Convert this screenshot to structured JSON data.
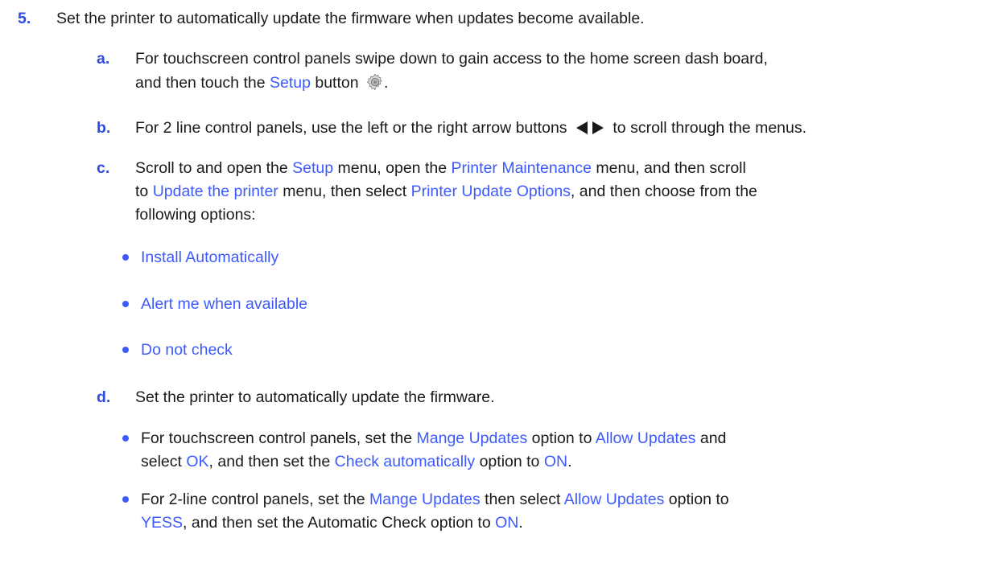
{
  "step5": {
    "num": "5.",
    "text": "Set the printer to automatically update the firmware when updates become available."
  },
  "a": {
    "label": "a.",
    "line1": "For touchscreen control panels swipe down to gain access to the home screen dash board,",
    "line2_pre": "and then touch the ",
    "line2_link": "Setup",
    "line2_mid": " button",
    "line2_post": "."
  },
  "b": {
    "label": "b.",
    "pre": "For 2 line control panels, use the left or the right arrow buttons",
    "post": "to scroll through the menus."
  },
  "c": {
    "label": "c.",
    "l1_pre": "Scroll to and open the ",
    "l1_link1": "Setup",
    "l1_mid": " menu, open the ",
    "l1_link2": "Printer Maintenance",
    "l1_post": " menu, and then scroll",
    "l2_pre": "to ",
    "l2_link1": "Update the printer",
    "l2_mid": " menu, then select ",
    "l2_link2": "Printer Update Options",
    "l2_post": ", and then choose from the",
    "l3": "following options:",
    "options": [
      "Install Automatically",
      "Alert me when available",
      "Do not check"
    ]
  },
  "d": {
    "label": "d.",
    "text": "Set the printer to automatically update the firmware.",
    "b1_l1_pre": "For touchscreen control panels, set the ",
    "b1_l1_link1": "Mange Updates",
    "b1_l1_mid": " option to ",
    "b1_l1_link2": "Allow Updates",
    "b1_l1_post": " and",
    "b1_l2_pre": "select ",
    "b1_l2_link1": "OK",
    "b1_l2_mid": ", and then set the ",
    "b1_l2_link2": "Check automatically",
    "b1_l2_mid2": " option to ",
    "b1_l2_link3": "ON",
    "b1_l2_post": ".",
    "b2_l1_pre": "For 2-line control panels, set the ",
    "b2_l1_link1": "Mange Updates",
    "b2_l1_mid": " then select ",
    "b2_l1_link2": "Allow Updates",
    "b2_l1_post": " option to",
    "b2_l2_link1": "YESS",
    "b2_l2_mid": ", and then set the Automatic Check option to ",
    "b2_l2_link2": "ON",
    "b2_l2_post": "."
  },
  "icons": {
    "setup": "gear-icon",
    "arrows": "left-right-arrows-icon"
  },
  "colors": {
    "link": "#3d5afe",
    "text": "#1a1a1a"
  }
}
